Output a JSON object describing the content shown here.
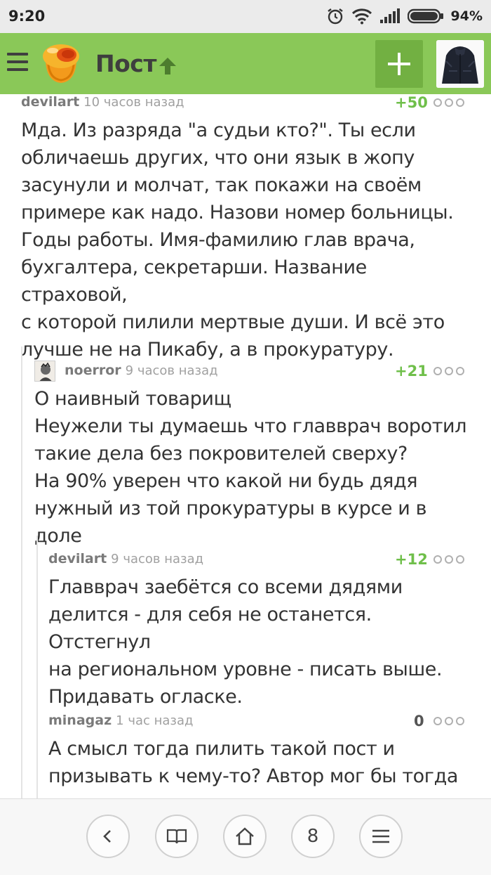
{
  "status": {
    "time": "9:20",
    "battery": "94%",
    "icons": [
      "alarm-icon",
      "wifi-icon",
      "signal-icon",
      "battery-icon"
    ]
  },
  "appbar": {
    "title": "Пост",
    "icons": [
      "menu-icon",
      "logo-icon",
      "up-arrow-icon",
      "plus-icon",
      "avatar-icon"
    ],
    "colors": {
      "bar": "#8ac858",
      "plus_bg": "#72b042"
    }
  },
  "comments": [
    {
      "user": "devilart",
      "time": "10 часов назад",
      "rating": "+50",
      "text": "Мда. Из разряда \"а судьи кто?\". Ты если\nобличаешь других, что они язык в жопу\nзасунули и молчат, так покажи на своём\nпримере как надо. Назови номер больницы.\nГоды работы. Имя-фамилию глав врача,\nбухгалтера, секретарши. Название страховой,\nс которой пилили мертвые души. И всё это\nлучше не на Пикабу, а в прокуратуру."
    },
    {
      "user": "noerror",
      "time": "9 часов назад",
      "rating": "+21",
      "text": "О наивный товарищ\nНеужели ты думаешь что главврач воротил\nтакие дела без покровителей сверху?\nНа 90% уверен что какой ни будь дядя\nнужный из той прокуратуры в курсе и в доле"
    },
    {
      "user": "devilart",
      "time": "9 часов назад",
      "rating": "+12",
      "text": "Главврач заебётся со всеми дядями\nделится - для себя не останется. Отстегнул\nна региональном уровне - писать выше.\nПридавать огласке."
    },
    {
      "user": "minagaz",
      "time": "1 час назад",
      "rating": "0",
      "text": "А смысл тогда пилить такой пост и\nпризывать к чему-то? Автор мог бы тогда"
    }
  ],
  "bottom_nav": {
    "icons": [
      "back-icon",
      "book-icon",
      "home-icon",
      "tabs-icon",
      "menu-icon"
    ],
    "tabs_count": "8"
  },
  "colors": {
    "positive_rating": "#6fbf4a",
    "text": "#333333",
    "meta": "#7a7a7a"
  }
}
